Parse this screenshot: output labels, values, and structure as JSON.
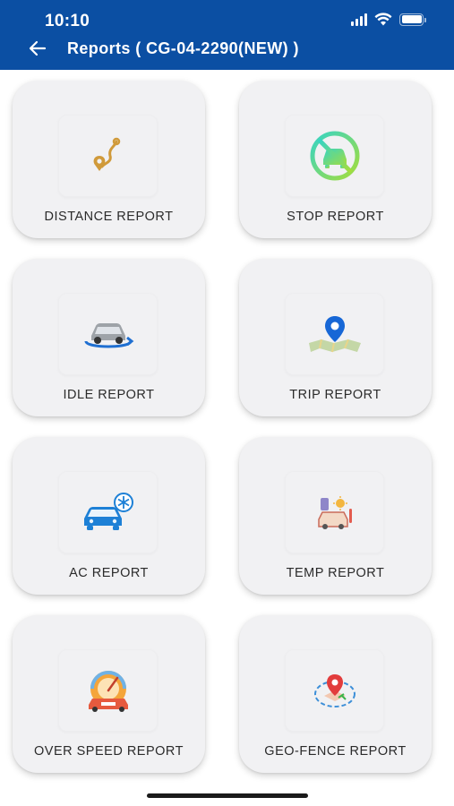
{
  "status_bar": {
    "time": "10:10"
  },
  "header": {
    "title": "Reports ( CG-04-2290(NEW) )"
  },
  "reports": [
    {
      "label": "DISTANCE REPORT",
      "icon": "route-pin-icon"
    },
    {
      "label": "STOP REPORT",
      "icon": "no-car-stop-icon"
    },
    {
      "label": "IDLE REPORT",
      "icon": "idle-car-icon"
    },
    {
      "label": "TRIP REPORT",
      "icon": "map-pin-icon"
    },
    {
      "label": "AC REPORT",
      "icon": "car-ac-icon"
    },
    {
      "label": "TEMP REPORT",
      "icon": "temperature-car-icon"
    },
    {
      "label": "OVER SPEED REPORT",
      "icon": "speedometer-car-icon"
    },
    {
      "label": "GEO-FENCE REPORT",
      "icon": "geofence-pin-icon"
    }
  ],
  "colors": {
    "header_bg": "#0b4fa3",
    "card_bg": "#f1f1f3"
  }
}
